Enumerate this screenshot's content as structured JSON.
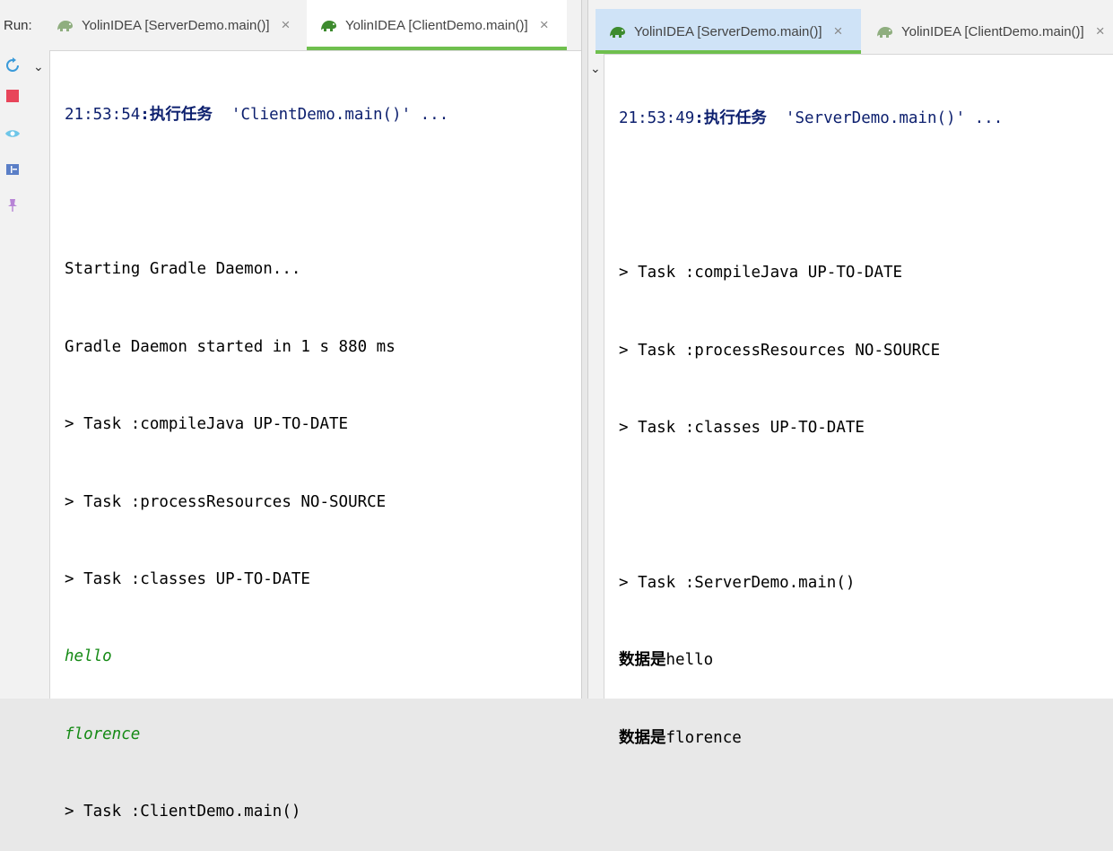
{
  "left": {
    "run_label": "Run:",
    "tabs": [
      {
        "label": "YolinIDEA [ServerDemo.main()]",
        "active": false
      },
      {
        "label": "YolinIDEA [ClientDemo.main()]",
        "active": true
      }
    ],
    "console": {
      "header_time": "21:53:54",
      "header_sep": ":",
      "header_action": "执行任务",
      "header_target": "'ClientDemo.main()' ...",
      "lines": [
        "Starting Gradle Daemon...",
        "Gradle Daemon started in 1 s 880 ms",
        "> Task :compileJava UP-TO-DATE",
        "> Task :processResources NO-SOURCE",
        "> Task :classes UP-TO-DATE"
      ],
      "output": [
        "hello",
        "florence"
      ],
      "last_line": "> Task :ClientDemo.main()"
    }
  },
  "right": {
    "tabs": [
      {
        "label": "YolinIDEA [ServerDemo.main()]",
        "active": true
      },
      {
        "label": "YolinIDEA [ClientDemo.main()]",
        "active": false
      }
    ],
    "console": {
      "header_time": "21:53:49",
      "header_sep": ":",
      "header_action": "执行任务",
      "header_target": "'ServerDemo.main()' ...",
      "lines": [
        "> Task :compileJava UP-TO-DATE",
        "> Task :processResources NO-SOURCE",
        "> Task :classes UP-TO-DATE"
      ],
      "task_line": "> Task :ServerDemo.main()",
      "data_prefix": "数据是",
      "data_values": [
        "hello",
        "florence"
      ]
    }
  },
  "icons": {
    "tab_icon": "gradle-elephant-icon",
    "close": "close-icon",
    "rerun": "rerun-icon",
    "stop": "stop-icon",
    "view": "eye-icon",
    "layout": "layout-icon",
    "pin": "pin-icon",
    "chevron": "chevron-down-icon"
  },
  "colors": {
    "accent_green": "#6fbf4e",
    "stop_red": "#e8455a",
    "output_green": "#158a15",
    "navy": "#0c1f6e"
  }
}
